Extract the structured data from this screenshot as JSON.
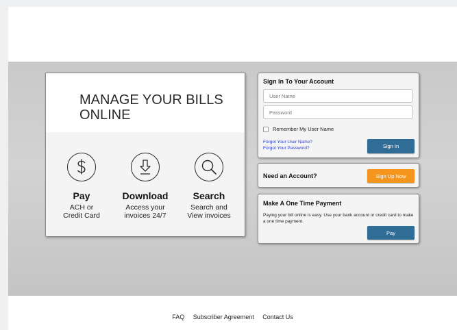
{
  "promo": {
    "title": "MANAGE YOUR BILLS ONLINE",
    "features": [
      {
        "icon": "dollar-icon",
        "title": "Pay",
        "desc": "ACH or\nCredit Card"
      },
      {
        "icon": "download-icon",
        "title": "Download",
        "desc": "Access your\ninvoices 24/7"
      },
      {
        "icon": "search-icon",
        "title": "Search",
        "desc": "Search and\nView invoices"
      }
    ]
  },
  "signin": {
    "title": "Sign In To Your Account",
    "username_placeholder": "User Name",
    "password_placeholder": "Password",
    "remember_label": "Remember My User Name",
    "forgot_username": "Forgot Your User Name?",
    "forgot_password": "Forgot Your Password?",
    "button": "Sign In"
  },
  "account": {
    "title": "Need an Account?",
    "button": "Sign Up Now"
  },
  "onetime": {
    "title": "Make A One Time Payment",
    "desc": "Paying your bill online is easy. Use your bank account or credit card to make a one time payment.",
    "button": "Pay"
  },
  "footer": {
    "links": [
      "FAQ",
      "Subscriber Agreement",
      "Contact Us"
    ]
  },
  "colors": {
    "button_blue": "#2f6d96",
    "button_orange": "#f4951e",
    "link_blue": "#2a3fd0"
  }
}
